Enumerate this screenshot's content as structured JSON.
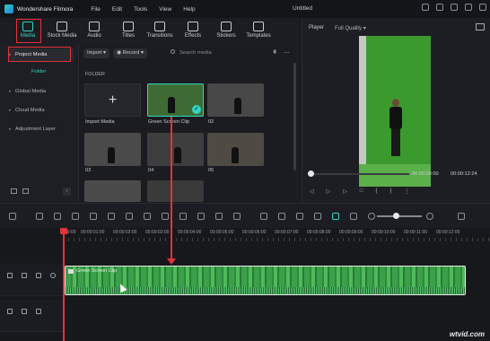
{
  "app": {
    "name": "Wondershare Filmora",
    "menu": [
      "File",
      "Edit",
      "Tools",
      "View",
      "Help"
    ],
    "doc_title": "Untitled"
  },
  "toolbar": {
    "tabs": [
      "Media",
      "Stock Media",
      "Audio",
      "Titles",
      "Transitions",
      "Effects",
      "Stickers",
      "Templates"
    ],
    "active": "Media"
  },
  "left_panel": {
    "project_media": "Project Media",
    "folder": "Folder",
    "items": [
      "Global Media",
      "Cloud Media",
      "Adjustment Layer"
    ]
  },
  "media": {
    "import_btn": "Import",
    "record_btn": "Record",
    "search_placeholder": "Search media",
    "folder_label": "FOLDER",
    "items": [
      {
        "label": "Import Media"
      },
      {
        "label": "Green Screen Clip"
      },
      {
        "label": "02"
      },
      {
        "label": "03"
      },
      {
        "label": "04"
      },
      {
        "label": "05"
      }
    ]
  },
  "player": {
    "label": "Player",
    "quality": "Full Quality",
    "time_current": "00:00:00:00",
    "time_total": "00:00:12:24"
  },
  "timeline": {
    "ticks": [
      "00:00",
      "00:00:01:00",
      "00:00:02:00",
      "00:00:03:00",
      "00:00:04:00",
      "00:00:05:00",
      "00:00:06:00",
      "00:00:07:00",
      "00:00:08:00",
      "00:00:09:00",
      "00:00:10:00",
      "00:00:11:00",
      "00:00:12:00"
    ],
    "clip_name": "Green Screen Clip"
  },
  "watermark": "wtvid.com",
  "colors": {
    "accent": "#33d6c2",
    "highlight_red": "#e0333a",
    "green_screen": "#3b9a2e"
  }
}
